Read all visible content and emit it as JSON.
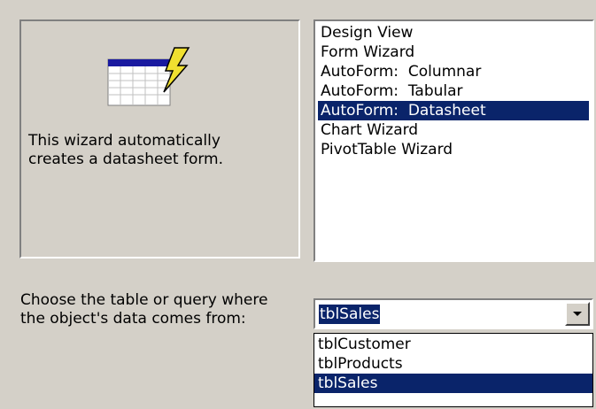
{
  "preview": {
    "description": "This wizard automatically\ncreates a datasheet form."
  },
  "view_list": {
    "items": [
      "Design View",
      "Form Wizard",
      "AutoForm:  Columnar",
      "AutoForm:  Tabular",
      "AutoForm:  Datasheet",
      "Chart Wizard",
      "PivotTable Wizard"
    ],
    "selected_index": 4
  },
  "table_source": {
    "label": "Choose the table or query where\nthe object's data comes from:",
    "selected_value": "tblSales",
    "options": [
      "tblCustomer",
      "tblProducts",
      "tblSales"
    ],
    "selected_index": 2
  },
  "colors": {
    "dialog_bg": "#d4d0c8",
    "selection_bg": "#0a246a",
    "selection_fg": "#ffffff",
    "icon_header": "#1a1aa0",
    "lightning": "#f0e030"
  }
}
